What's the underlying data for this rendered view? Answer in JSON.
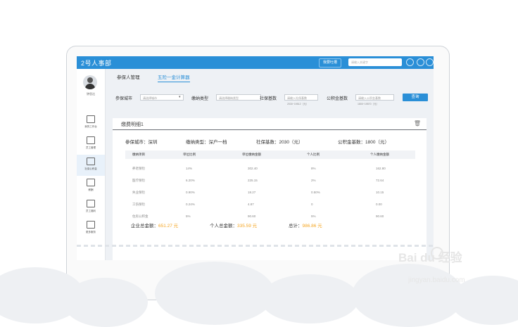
{
  "app": {
    "title": "2号人事部"
  },
  "topbar": {
    "feedback_label": "我要吐槽",
    "search_placeholder": "请输入关键字"
  },
  "sidebar": {
    "user_name": "钟思达",
    "items": [
      {
        "label": "我的工作台",
        "icon": "monitor-icon"
      },
      {
        "label": "员工管理",
        "icon": "user-card-icon"
      },
      {
        "label": "社保公积金",
        "icon": "home-icon"
      },
      {
        "label": "薪酬",
        "icon": "wallet-icon"
      },
      {
        "label": "员工福利",
        "icon": "gift-icon"
      },
      {
        "label": "更多服务",
        "icon": "grid-icon"
      }
    ]
  },
  "tabs": [
    {
      "label": "参保人管理",
      "active": false
    },
    {
      "label": "五险一金计算器",
      "active": true
    }
  ],
  "filters": {
    "city_label": "参保城市",
    "city_placeholder": "请选择城市",
    "type_label": "缴纳类型",
    "type_placeholder": "请选择缴纳类型",
    "social_base_label": "社保基数",
    "social_base_placeholder": "请输入社保基数",
    "social_base_hint": "2030~19512（元）",
    "fund_base_label": "公积金基数",
    "fund_base_placeholder": "请输入公积金基数",
    "fund_base_hint": "1800~19570（元）",
    "query_label": "查询"
  },
  "detail": {
    "title": "缴费明细1",
    "summary": {
      "city": "参保城市：深圳",
      "type": "缴纳类型：深户一档",
      "social_base": "社保基数：2030（元）",
      "fund_base": "公积金基数：1800（元）"
    },
    "table": {
      "headers": [
        "缴纳项目",
        "单位比例",
        "单位缴纳金额",
        "个人比例",
        "个人缴纳金额"
      ],
      "rows": [
        [
          "养老保险",
          "14%",
          "302.40",
          "8%",
          "162.80"
        ],
        [
          "医疗保险",
          "6.20%",
          "225.15",
          "2%",
          "72.64"
        ],
        [
          "失业保险",
          "0.90%",
          "18.27",
          "0.50%",
          "10.15"
        ],
        [
          "工伤保险",
          "0.24%",
          "4.87",
          "0",
          "0.00"
        ],
        [
          "住房公积金",
          "5%",
          "90.60",
          "5%",
          "90.60"
        ]
      ]
    },
    "totals": {
      "company_label": "企业总金额：",
      "company_value": "651.27 元",
      "personal_label": "个人总金额：",
      "personal_value": "335.59 元",
      "total_label": "总计：",
      "total_value": "986.86 元"
    }
  },
  "watermark": {
    "main": "Bai du 经验",
    "sub": "jingyan.baidu.com"
  },
  "colors": {
    "brand": "#2a8fd7",
    "highlight": "#f5a623"
  }
}
